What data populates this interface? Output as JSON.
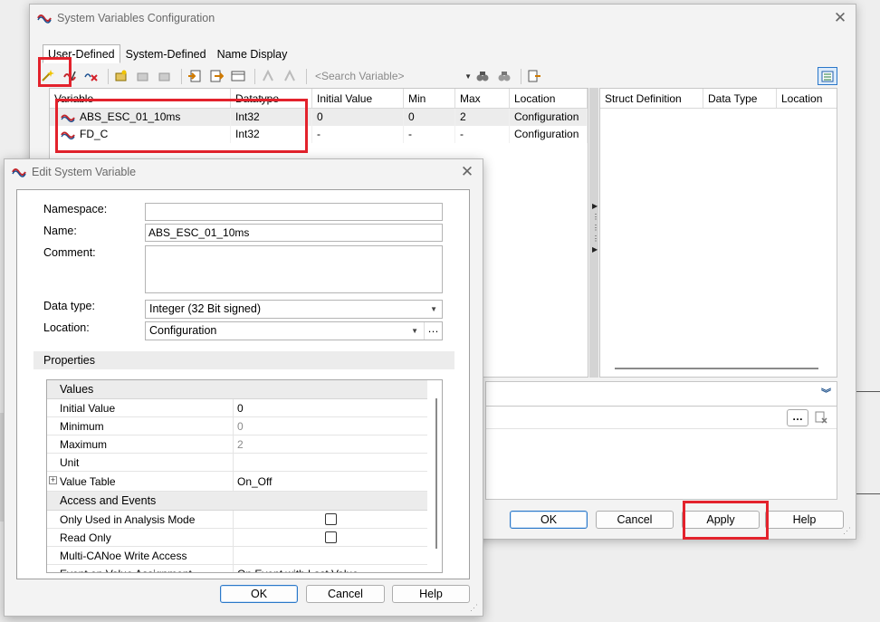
{
  "main_window": {
    "title": "System Variables Configuration",
    "tabs": [
      "User-Defined",
      "System-Defined",
      "Name Display"
    ],
    "toolbar": {
      "search_placeholder": "<Search Variable>"
    },
    "grid": {
      "columns": [
        "Variable",
        "Datatype",
        "Initial Value",
        "Min",
        "Max",
        "Location"
      ],
      "rows": [
        {
          "variable": "ABS_ESC_01_10ms",
          "datatype": "Int32",
          "initial": "0",
          "min": "0",
          "max": "2",
          "location": "Configuration"
        },
        {
          "variable": "FD_C",
          "datatype": "Int32",
          "initial": "-",
          "min": "-",
          "max": "-",
          "location": "Configuration"
        }
      ]
    },
    "struct_grid": {
      "columns": [
        "Struct Definition",
        "Data Type",
        "Location"
      ]
    },
    "lower_panel": {
      "more_label": "…"
    },
    "buttons": {
      "ok": "OK",
      "cancel": "Cancel",
      "apply": "Apply",
      "help": "Help"
    }
  },
  "edit_window": {
    "title": "Edit System Variable",
    "fields": {
      "namespace_label": "Namespace:",
      "namespace_value": "",
      "name_label": "Name:",
      "name_value": "ABS_ESC_01_10ms",
      "comment_label": "Comment:",
      "comment_value": "",
      "datatype_label": "Data type:",
      "datatype_value": "Integer (32 Bit signed)",
      "location_label": "Location:",
      "location_value": "Configuration"
    },
    "properties_header": "Properties",
    "property_grid": {
      "values_category": "Values",
      "values_rows": [
        {
          "key": "Initial Value",
          "value": "0"
        },
        {
          "key": "Minimum",
          "value": "0"
        },
        {
          "key": "Maximum",
          "value": "2"
        },
        {
          "key": "Unit",
          "value": ""
        },
        {
          "key": "Value Table",
          "value": "On_Off"
        }
      ],
      "access_category": "Access and Events",
      "access_rows": [
        {
          "key": "Only Used in Analysis Mode",
          "checked": false
        },
        {
          "key": "Read Only",
          "checked": false
        },
        {
          "key": "Multi-CANoe Write Access",
          "value": ""
        },
        {
          "key": "Event on Value Assignment",
          "value": "On Event with Last Value"
        }
      ]
    },
    "buttons": {
      "ok": "OK",
      "cancel": "Cancel",
      "help": "Help"
    }
  },
  "colors": {
    "highlight_red": "#e3222c",
    "accent_blue": "#2b78c8"
  },
  "icons": [
    "sysvar-app-icon",
    "new-variable-icon",
    "edit-icon",
    "delete-icon",
    "import-icon",
    "export-icon",
    "find-icon",
    "columns-icon",
    "panel-toggle-icon",
    "expand-icon",
    "clear-icon",
    "close-icon"
  ]
}
